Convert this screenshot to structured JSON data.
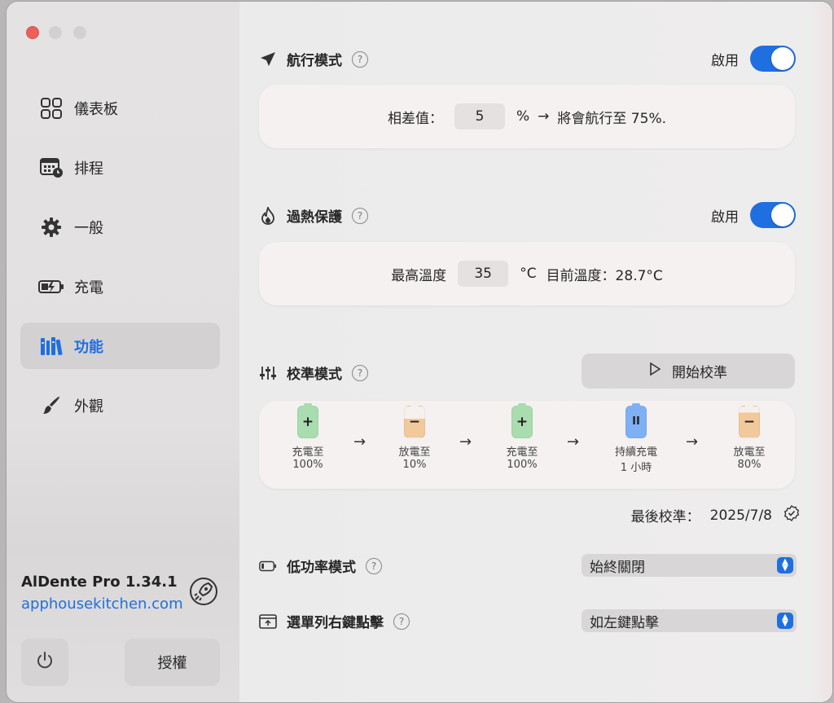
{
  "sidebar": {
    "items": [
      {
        "label": "儀表板",
        "icon": "dashboard-icon"
      },
      {
        "label": "排程",
        "icon": "calendar-clock-icon"
      },
      {
        "label": "一般",
        "icon": "gear-icon"
      },
      {
        "label": "充電",
        "icon": "battery-charging-icon"
      },
      {
        "label": "功能",
        "icon": "books-icon",
        "active": true
      },
      {
        "label": "外觀",
        "icon": "paintbrush-icon"
      }
    ],
    "app_name": "AlDente Pro 1.34.1",
    "website": "apphousekitchen.com",
    "license_button": "授權"
  },
  "sailing": {
    "title": "航行模式",
    "enable_label": "啟用",
    "enabled": true,
    "diff_label": "相差值：",
    "diff_value": "5",
    "unit": "%",
    "result_text": "將會航行至 75%."
  },
  "heat": {
    "title": "過熱保護",
    "enable_label": "啟用",
    "enabled": true,
    "max_label": "最高溫度",
    "max_value": "35",
    "unit": "°C",
    "current_text": "目前溫度：28.7°C"
  },
  "calibration": {
    "title": "校準模式",
    "start_button": "開始校準",
    "steps": [
      {
        "line1": "充電至",
        "line2": "100%",
        "symbol": "+",
        "color": "#a9dcae"
      },
      {
        "line1": "放電至",
        "line2": "10%",
        "symbol": "−",
        "color": "#f2c99a"
      },
      {
        "line1": "充電至",
        "line2": "100%",
        "symbol": "+",
        "color": "#a9dcae"
      },
      {
        "line1": "持續充電",
        "line2": "1 小時",
        "symbol": "II",
        "color": "#7fb0f3"
      },
      {
        "line1": "放電至",
        "line2": "80%",
        "symbol": "−",
        "color": "#f2c99a"
      }
    ],
    "last_label": "最後校準：",
    "last_date": "2025/7/8"
  },
  "low_power": {
    "title": "低功率模式",
    "value": "始終關閉"
  },
  "menu_right_click": {
    "title": "選單列右鍵點擊",
    "value": "如左鍵點擊"
  },
  "colors": {
    "accent": "#1f6fe0"
  }
}
